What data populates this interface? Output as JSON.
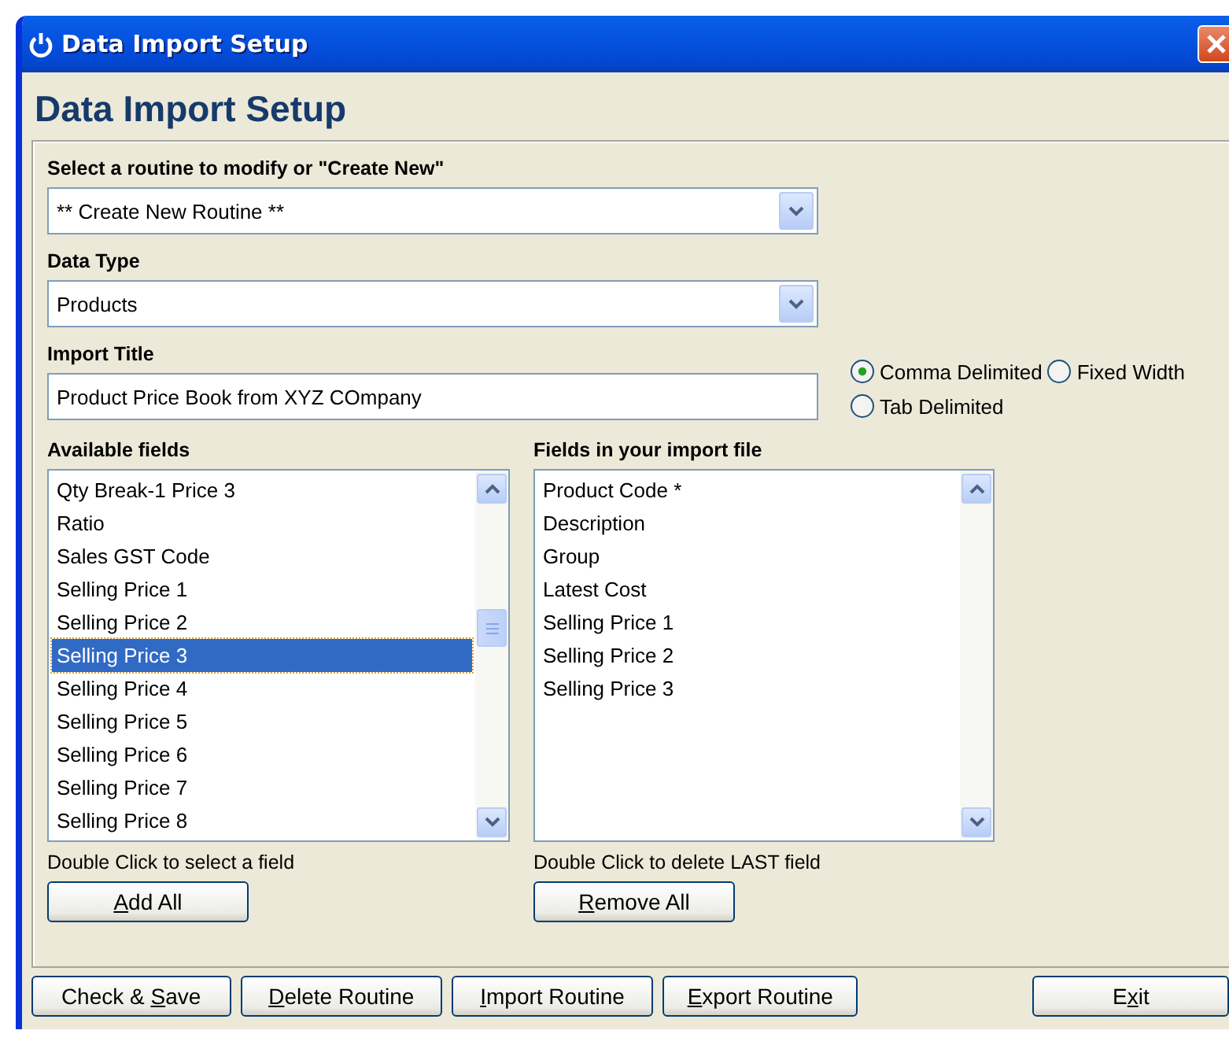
{
  "window": {
    "title": "Data Import Setup"
  },
  "heading": "Data Import Setup",
  "routine": {
    "label": "Select a routine to modify or \"Create New\"",
    "value": "** Create New Routine **"
  },
  "data_type": {
    "label": "Data Type",
    "value": "Products"
  },
  "import_title": {
    "label": "Import Title",
    "value": "Product Price Book from XYZ COmpany"
  },
  "formats": [
    {
      "label": "Comma Delimited",
      "selected": true
    },
    {
      "label": "Fixed Width",
      "selected": false
    },
    {
      "label": "Tab Delimited",
      "selected": false
    }
  ],
  "available_fields": {
    "label": "Available fields",
    "items": [
      {
        "label": "Qty Break-1 Price 3",
        "selected": false
      },
      {
        "label": "Ratio",
        "selected": false
      },
      {
        "label": "Sales GST Code",
        "selected": false
      },
      {
        "label": "Selling Price 1",
        "selected": false
      },
      {
        "label": "Selling Price 2",
        "selected": false
      },
      {
        "label": "Selling Price 3",
        "selected": true
      },
      {
        "label": "Selling Price 4",
        "selected": false
      },
      {
        "label": "Selling Price 5",
        "selected": false
      },
      {
        "label": "Selling Price 6",
        "selected": false
      },
      {
        "label": "Selling Price 7",
        "selected": false
      },
      {
        "label": "Selling Price 8",
        "selected": false
      }
    ],
    "hint": "Double Click to select a field",
    "button": {
      "key": "A",
      "after": "dd All"
    }
  },
  "import_fields": {
    "label": "Fields in your import file",
    "items": [
      {
        "label": "Product Code *",
        "selected": false
      },
      {
        "label": "Description",
        "selected": false
      },
      {
        "label": "Group",
        "selected": false
      },
      {
        "label": "Latest Cost",
        "selected": false
      },
      {
        "label": "Selling Price 1",
        "selected": false
      },
      {
        "label": "Selling Price 2",
        "selected": false
      },
      {
        "label": "Selling Price 3",
        "selected": false
      }
    ],
    "hint": "Double Click to delete LAST field",
    "button": {
      "key": "R",
      "after": "emove All"
    }
  },
  "buttons": [
    {
      "before": "Check & ",
      "key": "S",
      "after": "ave"
    },
    {
      "key": "D",
      "after": "elete Routine"
    },
    {
      "key": "I",
      "after": "mport Routine"
    },
    {
      "key": "E",
      "after": "xport Routine"
    },
    {
      "before": "E",
      "key": "x",
      "after": "it"
    }
  ]
}
